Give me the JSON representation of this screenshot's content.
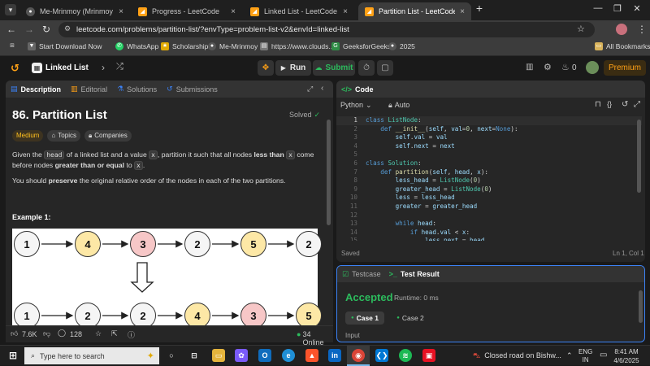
{
  "browser": {
    "tabs": [
      {
        "title": "Me-Mrinmoy (Mrinmoy Samanta)",
        "active": false
      },
      {
        "title": "Progress - LeetCode",
        "active": false
      },
      {
        "title": "Linked List - LeetCode",
        "active": false
      },
      {
        "title": "Partition List - LeetCode",
        "active": true
      }
    ],
    "url": "leetcode.com/problems/partition-list/?envType=problem-list-v2&envId=linked-list",
    "bookmarks": [
      "Start Download Now",
      "WhatsApp",
      "Scholarship",
      "Me-Mrinmoy",
      "https://www.clouds...",
      "GeeksforGeeks",
      "2025"
    ],
    "all_bookmarks": "All Bookmarks"
  },
  "lc_nav": {
    "list_name": "Linked List",
    "run": "Run",
    "submit": "Submit",
    "streak": "0",
    "premium": "Premium"
  },
  "left_panel": {
    "tabs": [
      "Description",
      "Editorial",
      "Solutions",
      "Submissions"
    ],
    "title": "86. Partition List",
    "solved": "Solved",
    "tags": [
      "Medium",
      "Topics",
      "Companies"
    ],
    "desc1": {
      "a": "Given the",
      "b": "head",
      "c": "of a linked list and a value",
      "d": "x",
      "e": ", partition it such that all nodes",
      "f": "less than",
      "g": "x",
      "h": "come before nodes",
      "i": "greater than or equal",
      "j": "to",
      "k": "x",
      "l": "."
    },
    "desc2": {
      "a": "You should",
      "b": "preserve",
      "c": "the original relative order of the nodes in each of the two partitions."
    },
    "example": "Example 1:",
    "list_top": [
      "1",
      "4",
      "3",
      "2",
      "5",
      "2"
    ],
    "list_bottom": [
      "1",
      "2",
      "2",
      "4",
      "3",
      "5"
    ],
    "likes": "7.6K",
    "comments": "128",
    "online": "34 Online"
  },
  "code_panel": {
    "title": "Code",
    "language": "Python",
    "auto": "Auto",
    "saved": "Saved",
    "cursor": "Ln 1, Col 1",
    "line_numbers": [
      "1",
      "2",
      "3",
      "4",
      "5",
      "6",
      "7",
      "8",
      "9",
      "10",
      "11",
      "12",
      "13",
      "14",
      "15"
    ]
  },
  "result_panel": {
    "tabs": [
      "Testcase",
      "Test Result"
    ],
    "status": "Accepted",
    "runtime": "Runtime: 0 ms",
    "cases": [
      "Case 1",
      "Case 2"
    ],
    "input_label": "Input"
  },
  "taskbar": {
    "search": "Type here to search",
    "notice": "Closed road on Bishw...",
    "lang": "ENG",
    "region": "IN",
    "time": "8:41 AM",
    "date": "4/6/2025"
  },
  "colors": {
    "accent": "#ffa116",
    "easy": "#ffc01e",
    "accepted": "#2cbb5d",
    "node_yellow": "#fde8a6",
    "node_red": "#f7c7c7"
  }
}
